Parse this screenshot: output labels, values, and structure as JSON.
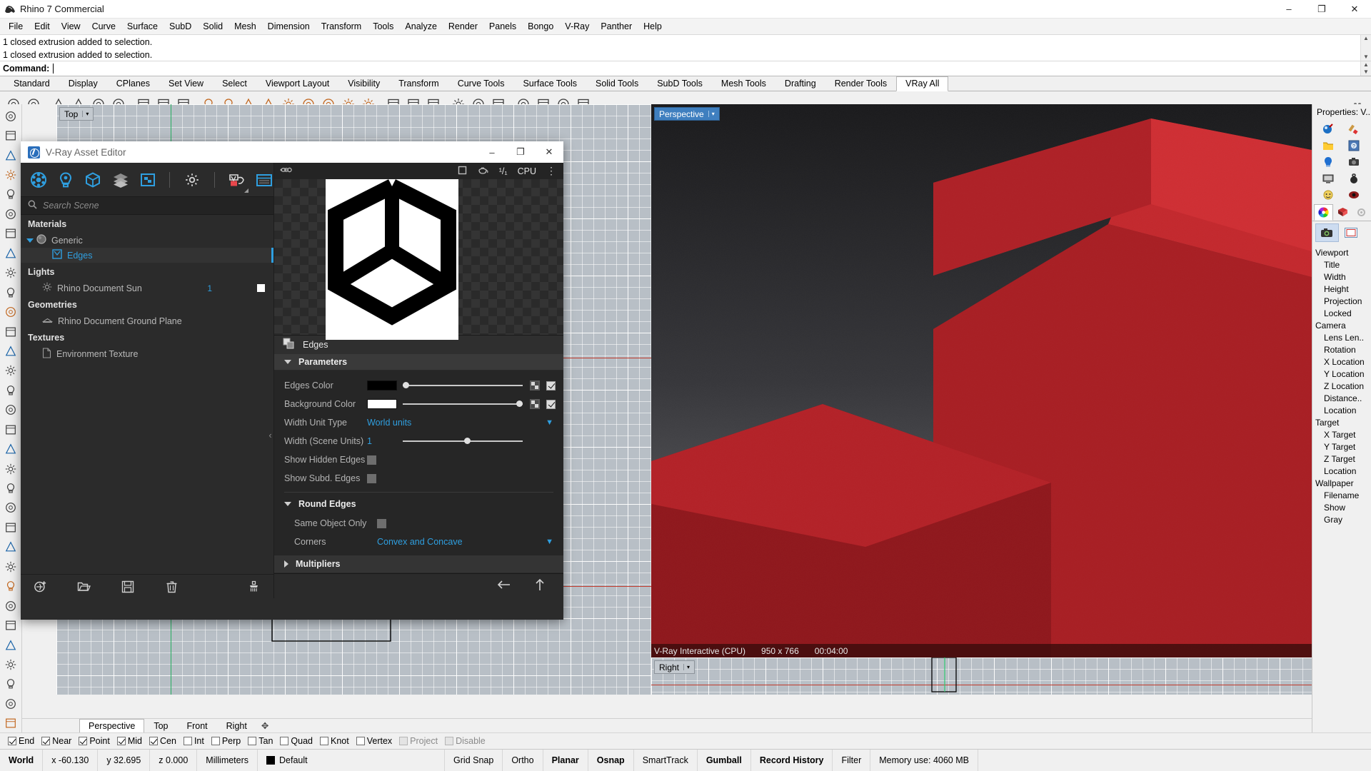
{
  "window": {
    "title": "Rhino 7 Commercial",
    "minimize": "–",
    "maximize": "❐",
    "close": "✕"
  },
  "menubar": {
    "items": [
      "File",
      "Edit",
      "View",
      "Curve",
      "Surface",
      "SubD",
      "Solid",
      "Mesh",
      "Dimension",
      "Transform",
      "Tools",
      "Analyze",
      "Render",
      "Panels",
      "Bongo",
      "V-Ray",
      "Panther",
      "Help"
    ]
  },
  "command": {
    "history_line1": "1 closed extrusion added to selection.",
    "history_line2": "1 closed extrusion added to selection.",
    "prompt_label": "Command:",
    "prompt_value": ""
  },
  "toolbar_tabs": {
    "items": [
      "Standard",
      "Display",
      "CPlanes",
      "Set View",
      "Select",
      "Viewport Layout",
      "Visibility",
      "Transform",
      "Curve Tools",
      "Surface Tools",
      "Solid Tools",
      "SubD Tools",
      "Mesh Tools",
      "Drafting",
      "Render Tools",
      "VRay All"
    ],
    "active": "VRay All"
  },
  "viewports": {
    "top": {
      "label": "Top",
      "arrow": "▾"
    },
    "perspective": {
      "label": "Perspective",
      "arrow": "▾"
    },
    "right": {
      "label": "Right",
      "arrow": "▾"
    },
    "render_status": {
      "engine": "V-Ray Interactive (CPU)",
      "resolution": "950 x 766",
      "time": "00:04:00"
    }
  },
  "viewport_tabs": {
    "items": [
      "Perspective",
      "Top",
      "Front",
      "Right"
    ],
    "active": "Perspective",
    "add": "✥"
  },
  "properties_panel": {
    "title": "Properties: V...",
    "icons": [
      "object-properties-icon",
      "material-icon",
      "layer-folder-icon",
      "display-icon",
      "light-icon",
      "camera-icon",
      "display-mode-icon",
      "weight-icon",
      "sun-icon",
      "render-icon"
    ],
    "tab_icons": [
      "color-wheel-icon",
      "material-layer-icon",
      "gear-icon"
    ],
    "subtab_icons": [
      "camera-icon",
      "frame-icon"
    ],
    "sections": [
      {
        "name": "Viewport",
        "rows": [
          "Title",
          "Width",
          "Height",
          "Projection",
          "Locked"
        ]
      },
      {
        "name": "Camera",
        "rows": [
          "Lens Len..",
          "Rotation",
          "X Location",
          "Y Location",
          "Z Location",
          "Distance..",
          "Location"
        ]
      },
      {
        "name": "Target",
        "rows": [
          "X Target",
          "Y Target",
          "Z Target",
          "Location"
        ]
      },
      {
        "name": "Wallpaper",
        "rows": [
          "Filename",
          "Show",
          "Gray"
        ]
      }
    ]
  },
  "osnap": {
    "items": [
      {
        "label": "End",
        "checked": true,
        "disabled": false
      },
      {
        "label": "Near",
        "checked": true,
        "disabled": false
      },
      {
        "label": "Point",
        "checked": true,
        "disabled": false
      },
      {
        "label": "Mid",
        "checked": true,
        "disabled": false
      },
      {
        "label": "Cen",
        "checked": true,
        "disabled": false
      },
      {
        "label": "Int",
        "checked": false,
        "disabled": false
      },
      {
        "label": "Perp",
        "checked": false,
        "disabled": false
      },
      {
        "label": "Tan",
        "checked": false,
        "disabled": false
      },
      {
        "label": "Quad",
        "checked": false,
        "disabled": false
      },
      {
        "label": "Knot",
        "checked": false,
        "disabled": false
      },
      {
        "label": "Vertex",
        "checked": false,
        "disabled": false
      },
      {
        "label": "Project",
        "checked": false,
        "disabled": true
      },
      {
        "label": "Disable",
        "checked": false,
        "disabled": true
      }
    ]
  },
  "statusbar": {
    "cplane": "World",
    "x": "x -60.130",
    "y": "y 32.695",
    "z": "z 0.000",
    "units": "Millimeters",
    "layer": "Default",
    "layer_color": "#000000",
    "toggles": [
      "Grid Snap",
      "Ortho",
      "Planar",
      "Osnap",
      "SmartTrack",
      "Gumball",
      "Record History",
      "Filter"
    ],
    "active_toggles": [
      "Planar",
      "Osnap",
      "Gumball",
      "Record History"
    ],
    "memory": "Memory use: 4060 MB"
  },
  "vray_editor": {
    "title": "V-Ray Asset Editor",
    "window_buttons": {
      "minimize": "–",
      "maximize": "❐",
      "close": "✕"
    },
    "toolbar_icons": [
      "materials-icon",
      "lights-icon",
      "geometry-icon",
      "textures-icon",
      "render-elements-icon",
      "settings-gear-icon",
      "render-interactive-icon",
      "render-frame-buffer-icon"
    ],
    "search": {
      "placeholder": "Search Scene",
      "value": ""
    },
    "tree": [
      {
        "group": "Materials",
        "items": [
          {
            "label": "Generic",
            "icon": "sphere-icon",
            "expandable": true,
            "selected": false
          },
          {
            "label": "Edges",
            "icon": "edges-tex-icon",
            "indent": true,
            "selected": true
          }
        ]
      },
      {
        "group": "Lights",
        "items": [
          {
            "label": "Rhino Document Sun",
            "icon": "sun-icon",
            "count": "1",
            "toggle": true
          }
        ]
      },
      {
        "group": "Geometries",
        "items": [
          {
            "label": "Rhino Document Ground Plane",
            "icon": "ground-plane-icon"
          }
        ]
      },
      {
        "group": "Textures",
        "items": [
          {
            "label": "Environment Texture",
            "icon": "file-icon"
          }
        ]
      }
    ],
    "tree_footer_icons": [
      "add-asset-icon",
      "open-file-icon",
      "save-icon",
      "delete-icon",
      "purge-icon"
    ],
    "preview": {
      "header_icons": [
        "preview-eye-icon",
        "resolution-icon",
        "teapot-icon"
      ],
      "ratio": "¹/₁",
      "device": "CPU",
      "menu": "⋮"
    },
    "asset": {
      "name": "Edges",
      "icon": "edges-tex-icon"
    },
    "rollups": [
      {
        "name": "Parameters",
        "open": true
      },
      {
        "name": "Round Edges",
        "open": true
      },
      {
        "name": "Multipliers",
        "open": false
      }
    ],
    "parameters": [
      {
        "label": "Edges Color",
        "type": "color",
        "color": "#000000",
        "slider": 0.0,
        "checked": true
      },
      {
        "label": "Background Color",
        "type": "color",
        "color": "#ffffff",
        "slider": 1.0,
        "checked": true
      },
      {
        "label": "Width Unit Type",
        "type": "select",
        "value": "World units"
      },
      {
        "label": "Width (Scene Units)",
        "type": "number",
        "value": "1",
        "slider": 0.52
      },
      {
        "label": "Show Hidden Edges",
        "type": "toggle",
        "value": false
      },
      {
        "label": "Show Subd. Edges",
        "type": "toggle",
        "value": false
      }
    ],
    "round_edges": [
      {
        "label": "Same Object Only",
        "type": "toggle",
        "value": false
      },
      {
        "label": "Corners",
        "type": "select",
        "value": "Convex and Concave"
      }
    ],
    "footer_icons": [
      "back-arrow-icon",
      "up-arrow-icon"
    ]
  },
  "colors": {
    "accent_blue": "#2f9fe0",
    "rhino_bg": "#f0f0f0",
    "vray_dark": "#2b2b2b",
    "render_red": "#b51f24",
    "viewport_gray": "#b8bfc6"
  }
}
